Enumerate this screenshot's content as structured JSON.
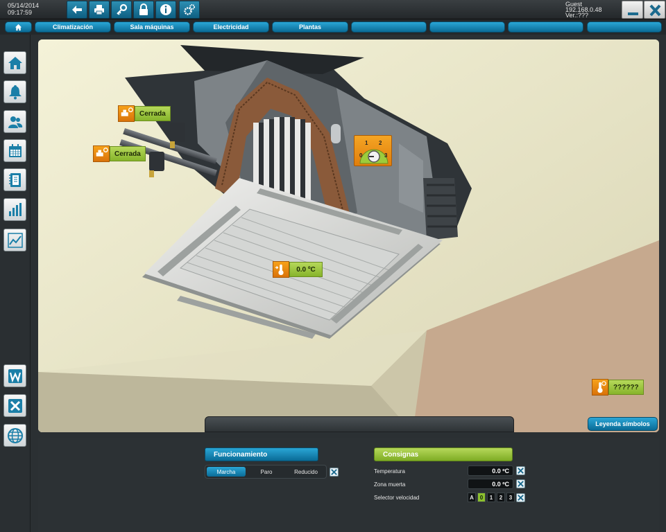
{
  "header": {
    "date": "05/14/2014",
    "time": "09:17:59",
    "user": "Guest",
    "ip": "192.168.0.48",
    "version": "Ver.:???",
    "toolbar_icons": [
      "back-icon",
      "print-icon",
      "key-icon",
      "lock-icon",
      "info-icon",
      "settings-icon"
    ]
  },
  "nav": {
    "tabs": [
      {
        "label": ""
      },
      {
        "label": "Climatización"
      },
      {
        "label": "Sala máquinas"
      },
      {
        "label": "Electricidad"
      },
      {
        "label": "Plantas"
      },
      {
        "label": ""
      },
      {
        "label": ""
      },
      {
        "label": ""
      },
      {
        "label": ""
      }
    ]
  },
  "sidebar": {
    "icons": [
      "home-icon",
      "alarm-bell-icon",
      "users-icon",
      "calendar-icon",
      "notebook-icon",
      "bar-chart-icon",
      "line-chart-icon",
      "word-export-icon",
      "excel-export-icon",
      "globe-icon"
    ]
  },
  "scene": {
    "valve1": {
      "label": "Cerrada"
    },
    "valve2": {
      "label": "Cerrada"
    },
    "fan_speed": {
      "marks": [
        "0",
        "1",
        "2",
        "3"
      ]
    },
    "supply_temp": {
      "label": "0.0 ºC"
    },
    "room_temp": {
      "label": "??????"
    },
    "legend_button": "Leyenda símbolos"
  },
  "funcionamiento": {
    "title": "Funcionamiento",
    "options": [
      "Marcha",
      "Paro",
      "Reducido"
    ],
    "selected": "Marcha"
  },
  "consignas": {
    "title": "Consignas",
    "temperatura_label": "Temperatura",
    "temperatura_value": "0.0 ºC",
    "zona_muerta_label": "Zona muerta",
    "zona_muerta_value": "0.0 ºC",
    "selector_label": "Selector velocidad",
    "selector_options": [
      "A",
      "0",
      "1",
      "2",
      "3"
    ],
    "selector_selected": "0"
  },
  "colors": {
    "accent_blue": "#1a8fc2",
    "accent_green": "#8cbf2e",
    "accent_orange": "#ee8c12"
  }
}
